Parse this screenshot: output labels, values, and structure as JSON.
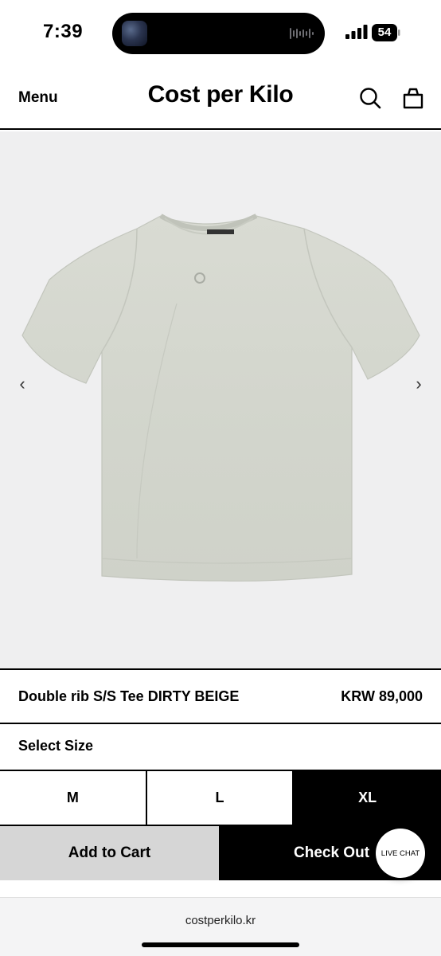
{
  "status_bar": {
    "time": "7:39",
    "battery": "54",
    "icons": [
      "now-playing-thumbnail",
      "audio-waveform-icon",
      "cellular-signal-icon",
      "battery-icon"
    ]
  },
  "header": {
    "menu_label": "Menu",
    "brand": "Cost per Kilo",
    "icons": [
      "search-icon",
      "shopping-bag-icon"
    ]
  },
  "gallery": {
    "image_subject": "t-shirt",
    "prev_arrow": "‹",
    "next_arrow": "›",
    "background_color": "#efeff0",
    "shirt_color": "#d6d8d0"
  },
  "product": {
    "name": "Double rib S/S Tee DIRTY BEIGE",
    "price": "KRW 89,000"
  },
  "size_section": {
    "label": "Select Size",
    "options": [
      "M",
      "L",
      "XL"
    ],
    "selected": "XL"
  },
  "actions": {
    "add_to_cart": "Add to Cart",
    "check_out": "Check Out",
    "live_chat": "LIVE CHAT"
  },
  "browser": {
    "url": "costperkilo.kr"
  },
  "colors": {
    "primary": "#000000",
    "secondary_button": "#d6d6d6",
    "background": "#ffffff"
  }
}
